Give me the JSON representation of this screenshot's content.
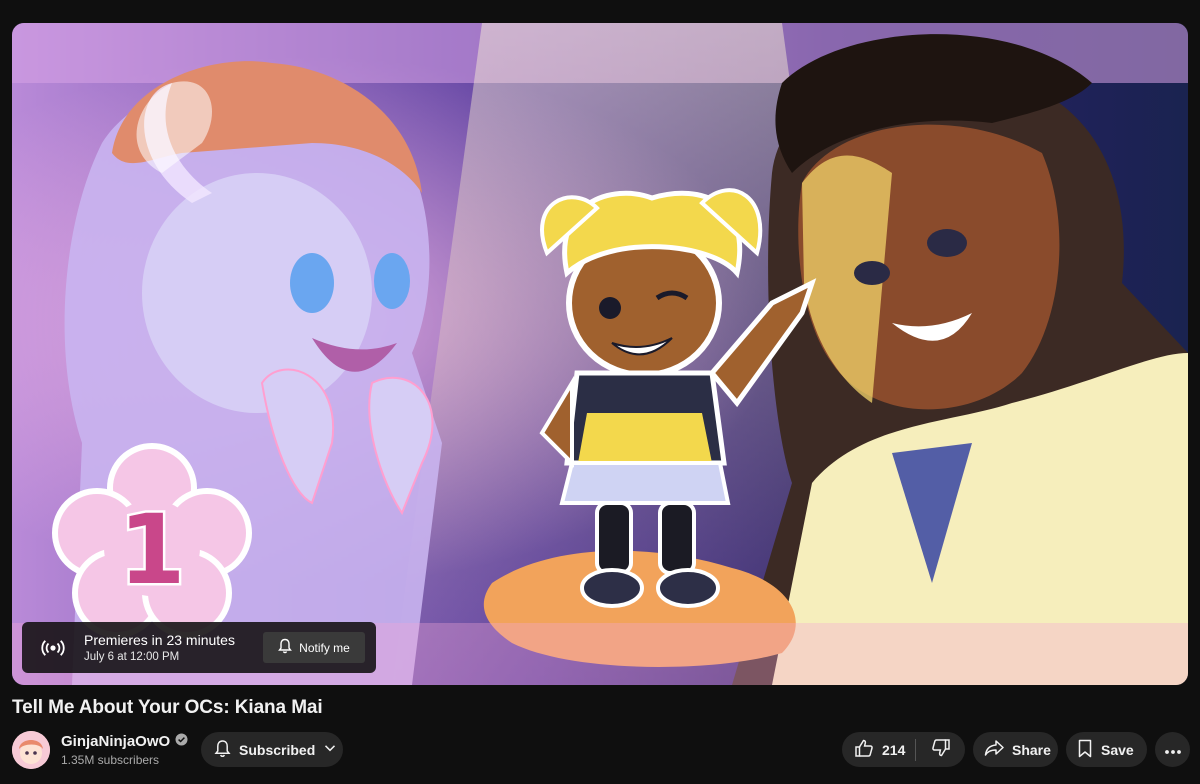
{
  "video": {
    "title": "Tell Me About Your OCs: Kiana Mai",
    "thumbnail_badge_number": "1"
  },
  "premiere": {
    "status": "Premieres in 23 minutes",
    "datetime": "July 6 at 12:00 PM",
    "notify_label": "Notify me",
    "icon": "live-broadcast-icon"
  },
  "channel": {
    "name": "GinjaNinjaOwO",
    "subscribers": "1.35M subscribers",
    "verified": true,
    "subscribed_label": "Subscribed"
  },
  "actions": {
    "like_count": "214",
    "share_label": "Share",
    "save_label": "Save"
  },
  "colors": {
    "background": "#0f0f0f",
    "pill": "#272727",
    "text_primary": "#f1f1f1",
    "text_secondary": "#aaaaaa"
  }
}
